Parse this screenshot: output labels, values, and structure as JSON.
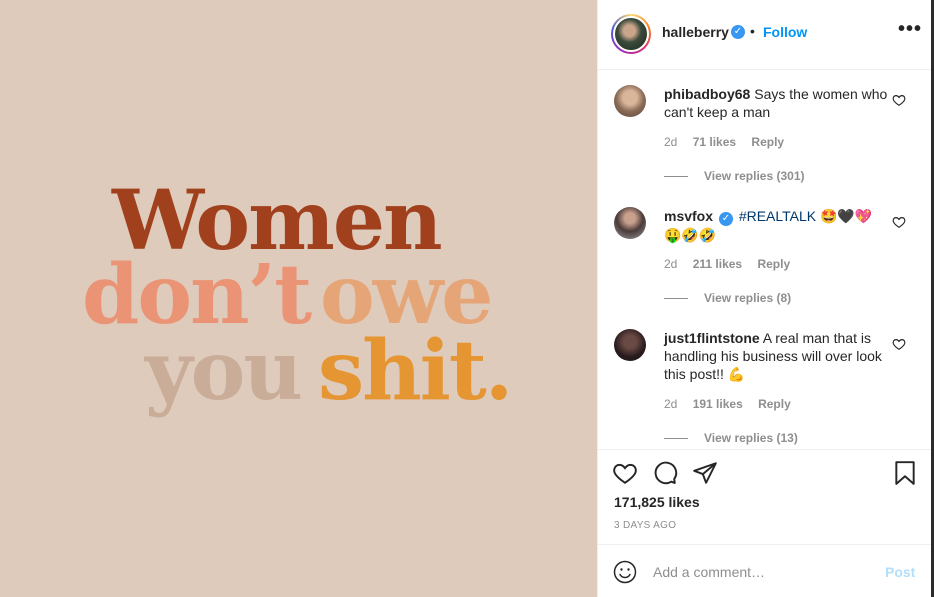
{
  "image": {
    "lines": [
      "Women",
      "don’t",
      "owe",
      "you",
      "shit."
    ],
    "colors": {
      "background": "#dfcbbc",
      "women": "#a0401c",
      "dont": "#eb9475",
      "owe": "#e6a577",
      "you": "#c9ad98",
      "shit": "#e59532"
    }
  },
  "header": {
    "username": "halleberry",
    "separator": "•",
    "follow_label": "Follow",
    "more_label": "•••"
  },
  "comments": [
    {
      "username": "phibadboy68",
      "text": "Says the women who can't keep a man",
      "age": "2d",
      "likes": "71 likes",
      "reply_label": "Reply",
      "view_replies": "View replies (301)"
    },
    {
      "username": "msvfox",
      "text_hashtag": "#REALTALK",
      "text_emojis_line1": "🤩🖤💖",
      "text_emojis_line2": "🤑🤣🤣",
      "age": "2d",
      "likes": "211 likes",
      "reply_label": "Reply",
      "view_replies": "View replies (8)"
    },
    {
      "username": "just1flintstone",
      "text": "A real man that is handling his business will over look this post!! 💪",
      "age": "2d",
      "likes": "191 likes",
      "reply_label": "Reply",
      "view_replies": "View replies (13)"
    }
  ],
  "actions": {
    "likes": "171,825 likes",
    "time_ago": "3 DAYS AGO",
    "icons": [
      "heart-icon",
      "comment-icon",
      "share-icon",
      "bookmark-icon"
    ]
  },
  "add_comment": {
    "placeholder": "Add a comment…",
    "post_label": "Post"
  },
  "colors": {
    "link_blue": "#0095f6",
    "verified_blue": "#3897f0",
    "post_disabled": "#b2dffc",
    "muted": "#8e8e8e"
  }
}
